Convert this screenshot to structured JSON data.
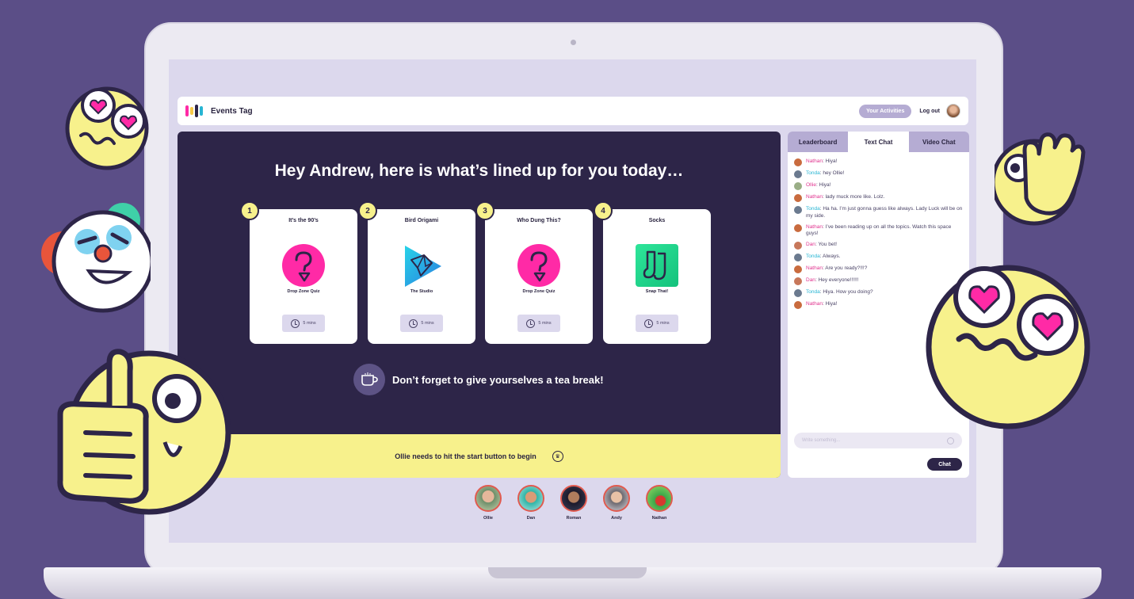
{
  "app": {
    "name": "Events Tag"
  },
  "header": {
    "activities_label": "Your Activities",
    "logout_label": "Log out"
  },
  "main": {
    "headline": "Hey Andrew, here is what’s lined up for you today…",
    "cards": [
      {
        "number": "1",
        "title": "It’s the 90’s",
        "subtitle": "Drop Zone Quiz",
        "duration": "5 mins",
        "icon": "question-mark-icon"
      },
      {
        "number": "2",
        "title": "Bird Origami",
        "subtitle": "The Studio",
        "duration": "5 mins",
        "icon": "origami-bird-icon"
      },
      {
        "number": "3",
        "title": "Who Dung This?",
        "subtitle": "Drop Zone Quiz",
        "duration": "5 mins",
        "icon": "question-mark-icon"
      },
      {
        "number": "4",
        "title": "Socks",
        "subtitle": "Snap That!",
        "duration": "5 mins",
        "icon": "socks-icon"
      }
    ],
    "tea_break": "Don’t forget to give yourselves a tea break!",
    "start_message": "Ollie needs to hit the start button to begin"
  },
  "chat": {
    "tabs": [
      "Leaderboard",
      "Text Chat",
      "Video Chat"
    ],
    "active_tab": "Text Chat",
    "messages": [
      {
        "name": "Nathan",
        "text": "Hiya!",
        "color": "#e0338f"
      },
      {
        "name": "Tonda",
        "text": "hey Ollie!",
        "color": "#27b5d3"
      },
      {
        "name": "Ollie",
        "text": "Hiya!",
        "color": "#e0338f"
      },
      {
        "name": "Nathan",
        "text": "lady muck more like. Lolz.",
        "color": "#e0338f"
      },
      {
        "name": "Tonda",
        "text": "Ha ha. I’m just gonna guess like always. Lady Luck will be on my side.",
        "color": "#27b5d3"
      },
      {
        "name": "Nathan",
        "text": "I’ve been reading up on all the topics. Watch this space guys!",
        "color": "#e0338f"
      },
      {
        "name": "Dan",
        "text": "You bet!",
        "color": "#e0338f"
      },
      {
        "name": "Tonda",
        "text": "Always.",
        "color": "#27b5d3"
      },
      {
        "name": "Nathan",
        "text": "Are you ready?!!!?",
        "color": "#e0338f"
      },
      {
        "name": "Dan",
        "text": "Hey everyone!!!!!!",
        "color": "#e0338f"
      },
      {
        "name": "Tonda",
        "text": "Hiya. How you doing?",
        "color": "#27b5d3"
      },
      {
        "name": "Nathan",
        "text": "Hiya!",
        "color": "#e0338f"
      }
    ],
    "input_placeholder": "Write something...",
    "send_label": "Chat"
  },
  "participants": [
    "Ollie",
    "Dan",
    "Roman",
    "Andy",
    "Nathan"
  ],
  "colors": {
    "background": "#5b4e87",
    "panel": "#2d2548",
    "accent_yellow": "#f7f18c",
    "accent_pink": "#ff2aa6",
    "lavender": "#b5acd3"
  }
}
